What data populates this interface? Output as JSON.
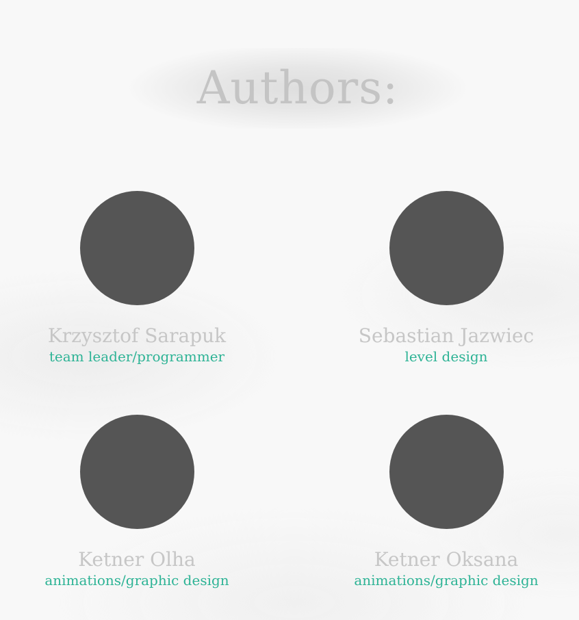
{
  "page": {
    "title": "Authors:"
  },
  "colors": {
    "avatar": "#555555",
    "name": "#c6c6c6",
    "role": "#2db395",
    "title": "#c4c4c4"
  },
  "authors": [
    {
      "name": "Krzysztof  Sarapuk",
      "role": "team leader/programmer"
    },
    {
      "name": "Sebastian Jazwiec",
      "role": "level design"
    },
    {
      "name": "Ketner Olha",
      "role": "animations/graphic design"
    },
    {
      "name": "Ketner Oksana",
      "role": "animations/graphic design"
    }
  ]
}
